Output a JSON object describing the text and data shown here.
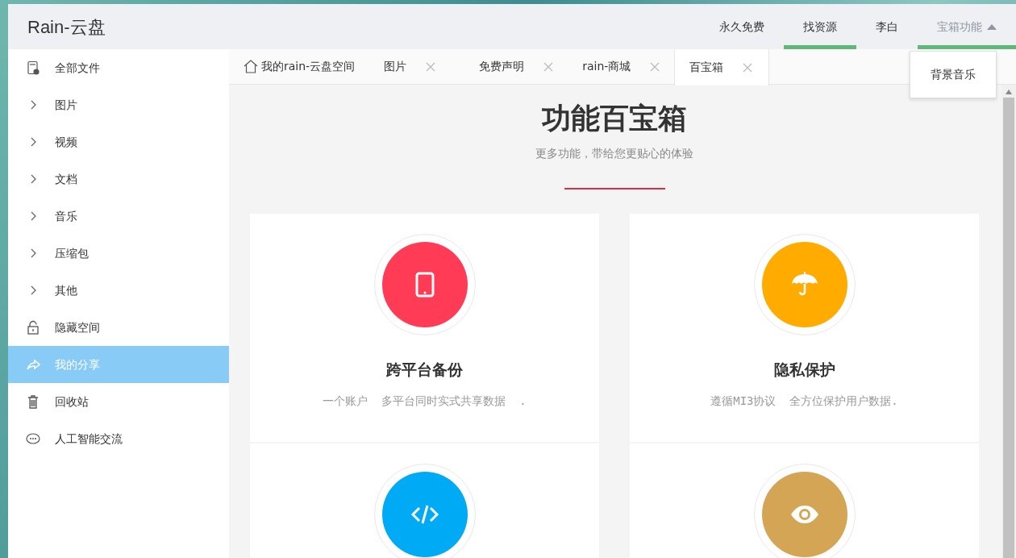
{
  "header": {
    "logo": "Rain-云盘",
    "nav": [
      {
        "label": "永久免费",
        "kind": "link",
        "underlined": false
      },
      {
        "label": "找资源",
        "kind": "link",
        "underlined": true
      },
      {
        "label": "李白",
        "kind": "link",
        "underlined": false
      },
      {
        "label": "宝箱功能",
        "kind": "dropdown",
        "underlined": true,
        "expanded": true
      }
    ],
    "dropdown_items": [
      "背景音乐"
    ]
  },
  "sidebar": {
    "items": [
      {
        "kind": "file",
        "label": "全部文件",
        "selected": false
      },
      {
        "kind": "folder",
        "label": "图片",
        "selected": false
      },
      {
        "kind": "folder",
        "label": "视频",
        "selected": false
      },
      {
        "kind": "folder",
        "label": "文档",
        "selected": false
      },
      {
        "kind": "folder",
        "label": "音乐",
        "selected": false
      },
      {
        "kind": "folder",
        "label": "压缩包",
        "selected": false
      },
      {
        "kind": "folder",
        "label": "其他",
        "selected": false
      },
      {
        "kind": "hidden",
        "label": "隐藏空间",
        "selected": false
      },
      {
        "kind": "share",
        "label": "我的分享",
        "selected": true
      },
      {
        "kind": "trash",
        "label": "回收站",
        "selected": false
      },
      {
        "kind": "chat",
        "label": "人工智能交流",
        "selected": false
      }
    ]
  },
  "tabs": [
    {
      "label": "我的rain-云盘空间",
      "kind": "home",
      "selected": false
    },
    {
      "label": "图片",
      "kind": "closable",
      "selected": false
    },
    {
      "label": "免费声明",
      "kind": "closable",
      "selected": false
    },
    {
      "label": "rain-商城",
      "kind": "closable",
      "selected": false
    },
    {
      "label": "百宝箱",
      "kind": "closable",
      "selected": true
    }
  ],
  "content": {
    "title": "功能百宝箱",
    "subtitle": "更多功能，带给您更贴心的体验",
    "features": [
      {
        "kind": "backup",
        "color": "#ff3b55",
        "title": "跨平台备份",
        "description": "一个账户  多平台同时实式共享数据  ."
      },
      {
        "kind": "privacy",
        "color": "#ffab00",
        "title": "隐私保护",
        "description": "遵循MI3协议  全方位保护用户数据."
      },
      {
        "kind": "code",
        "color": "#00aaf5"
      },
      {
        "kind": "view",
        "color": "#d4a554"
      }
    ]
  }
}
